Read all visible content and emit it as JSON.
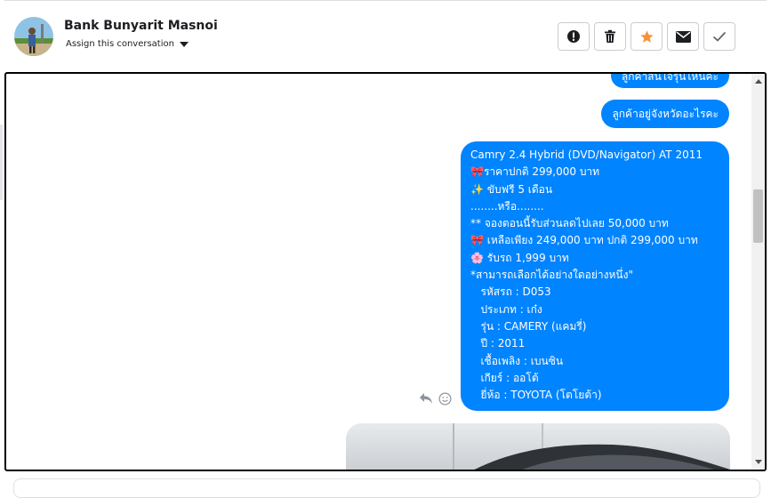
{
  "header": {
    "contact_name": "Bank Bunyarit Masnoi",
    "assign_label": "Assign this conversation",
    "actions": [
      {
        "icon": "alert-icon"
      },
      {
        "icon": "trash-icon"
      },
      {
        "icon": "star-icon",
        "color": "#f7923b"
      },
      {
        "icon": "envelope-icon"
      },
      {
        "icon": "checkmark-icon"
      }
    ]
  },
  "messages": {
    "partial_top": "ลูกค้าสนใจรุ่นไหนคะ",
    "province_question": "ลูกค้าอยู่จังหวัดอะไรคะ",
    "car_offer": {
      "lines": [
        "Camry 2.4 Hybrid (DVD/Navigator) AT 2011",
        "🎀ราคาปกติ 299,000 บาท",
        "✨ ขับฟรี 5 เดือน",
        "........หรือ........",
        "** จองตอนนี้รับส่วนลดไปเลย 50,000 บาท",
        "🎀 เหลือเพียง 249,000 บาท ปกติ 299,000 บาท",
        "🌸 รับรถ 1,999 บาท",
        "*สามารถเลือกได้อย่างใดอย่างหนึ่ง\"",
        "   รหัสรถ : D053",
        "   ประเภท : เก๋ง",
        "   รุ่น : CAMERY (แคมรี่)",
        "   ปี : 2011",
        "   เชื้อเพลิง : เบนซิน",
        "   เกียร์ : ออโต้",
        "   ยี่ห้อ : TOYOTA (โตโยต้า)"
      ]
    }
  },
  "colors": {
    "bubble": "#0084ff",
    "star": "#f7923b"
  }
}
